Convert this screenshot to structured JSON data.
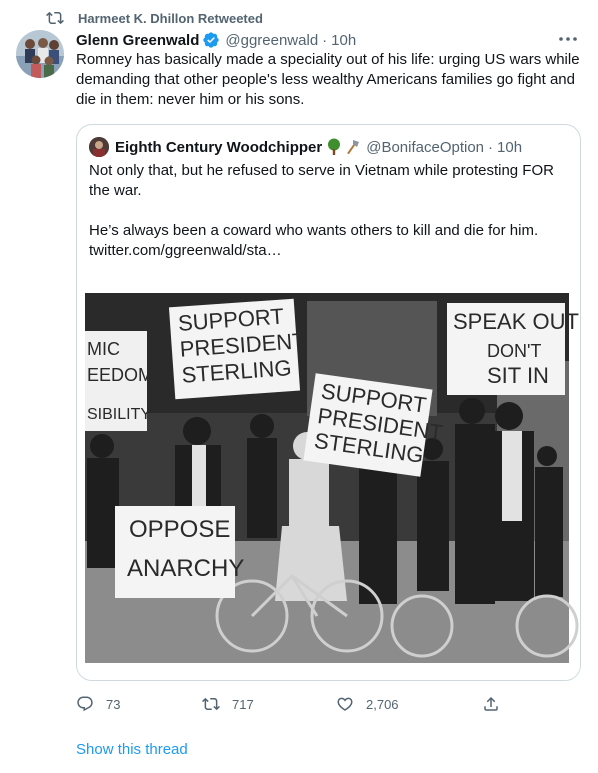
{
  "retweet_bar": {
    "icon": "retweet-icon",
    "text": "Harmeet K. Dhillon Retweeted"
  },
  "tweet": {
    "author_name": "Glenn Greenwald",
    "verified_icon": "verified-badge-icon",
    "handle": "@ggreenwald",
    "separator": "·",
    "time": "10h",
    "text": "Romney has basically made a speciality out of his life: urging US wars while demanding that other people's less wealthy Americans families go fight and die in them: never him or his sons."
  },
  "quote": {
    "author_name": "Eighth Century Woodchipper",
    "emoji": [
      "🌳",
      "🪓"
    ],
    "handle": "@BonifaceOption",
    "separator": "·",
    "time": "10h",
    "paragraph_1": "Not only that, but he refused to serve in Vietnam while protesting FOR the war.",
    "paragraph_2": "He’s always been a coward who wants others to kill and die for him.",
    "link": "twitter.com/ggreenwald/sta…",
    "photo": {
      "signs": [
        "SUPPORT",
        "PRESIDENT",
        "STERLING",
        "SPEAK OUT",
        "DON'T",
        "SIT IN",
        "OPPOSE",
        "ANARCHY",
        "MIC",
        "EEDOM",
        "SIBILITY"
      ]
    }
  },
  "actions": {
    "reply_count": "73",
    "retweet_count": "717",
    "like_count": "2,706",
    "icons": [
      "reply-icon",
      "retweet-icon",
      "like-icon",
      "share-icon"
    ]
  },
  "show_thread": "Show this thread",
  "colors": {
    "accent": "#1d9bf0",
    "secondary_text": "#536471",
    "border": "#cfd9de"
  }
}
